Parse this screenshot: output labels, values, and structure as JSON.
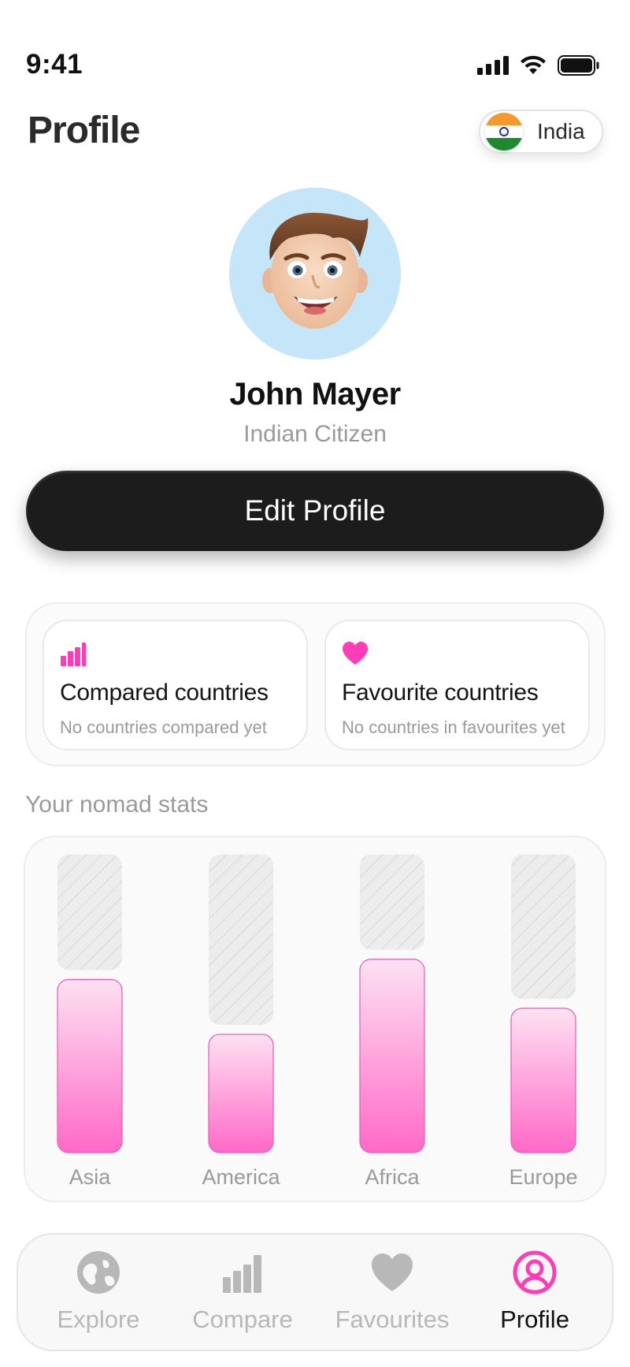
{
  "status_bar": {
    "time": "9:41"
  },
  "header": {
    "title": "Profile"
  },
  "country_chip": {
    "label": "India"
  },
  "profile": {
    "name": "John Mayer",
    "subtitle": "Indian Citizen",
    "edit_button": "Edit Profile"
  },
  "activity": {
    "compared": {
      "icon": "bar-chart-icon",
      "title": "Compared countries",
      "subtitle": "No countries compared yet"
    },
    "favourites": {
      "icon": "heart-icon",
      "title": "Favourite countries",
      "subtitle": "No countries in favourites yet"
    }
  },
  "stats": {
    "label": "Your nomad stats",
    "colors": {
      "fill": "#ff69c8",
      "fill_light": "#fde2f2",
      "empty": "#ececec"
    }
  },
  "chart_data": {
    "type": "bar",
    "categories": [
      "Asia",
      "America",
      "Africa",
      "Europe"
    ],
    "values": [
      0.6,
      0.41,
      0.67,
      0.5
    ],
    "ylim": [
      0,
      1
    ]
  },
  "tab_bar": {
    "tabs": [
      {
        "label": "Explore",
        "icon": "globe-icon",
        "active": false
      },
      {
        "label": "Compare",
        "icon": "bar-chart-icon",
        "active": false
      },
      {
        "label": "Favourites",
        "icon": "heart-icon",
        "active": false
      },
      {
        "label": "Profile",
        "icon": "user-circle-icon",
        "active": true
      }
    ],
    "colors": {
      "active_icon": "#ff3db8",
      "inactive": "#b8b8b8"
    }
  }
}
